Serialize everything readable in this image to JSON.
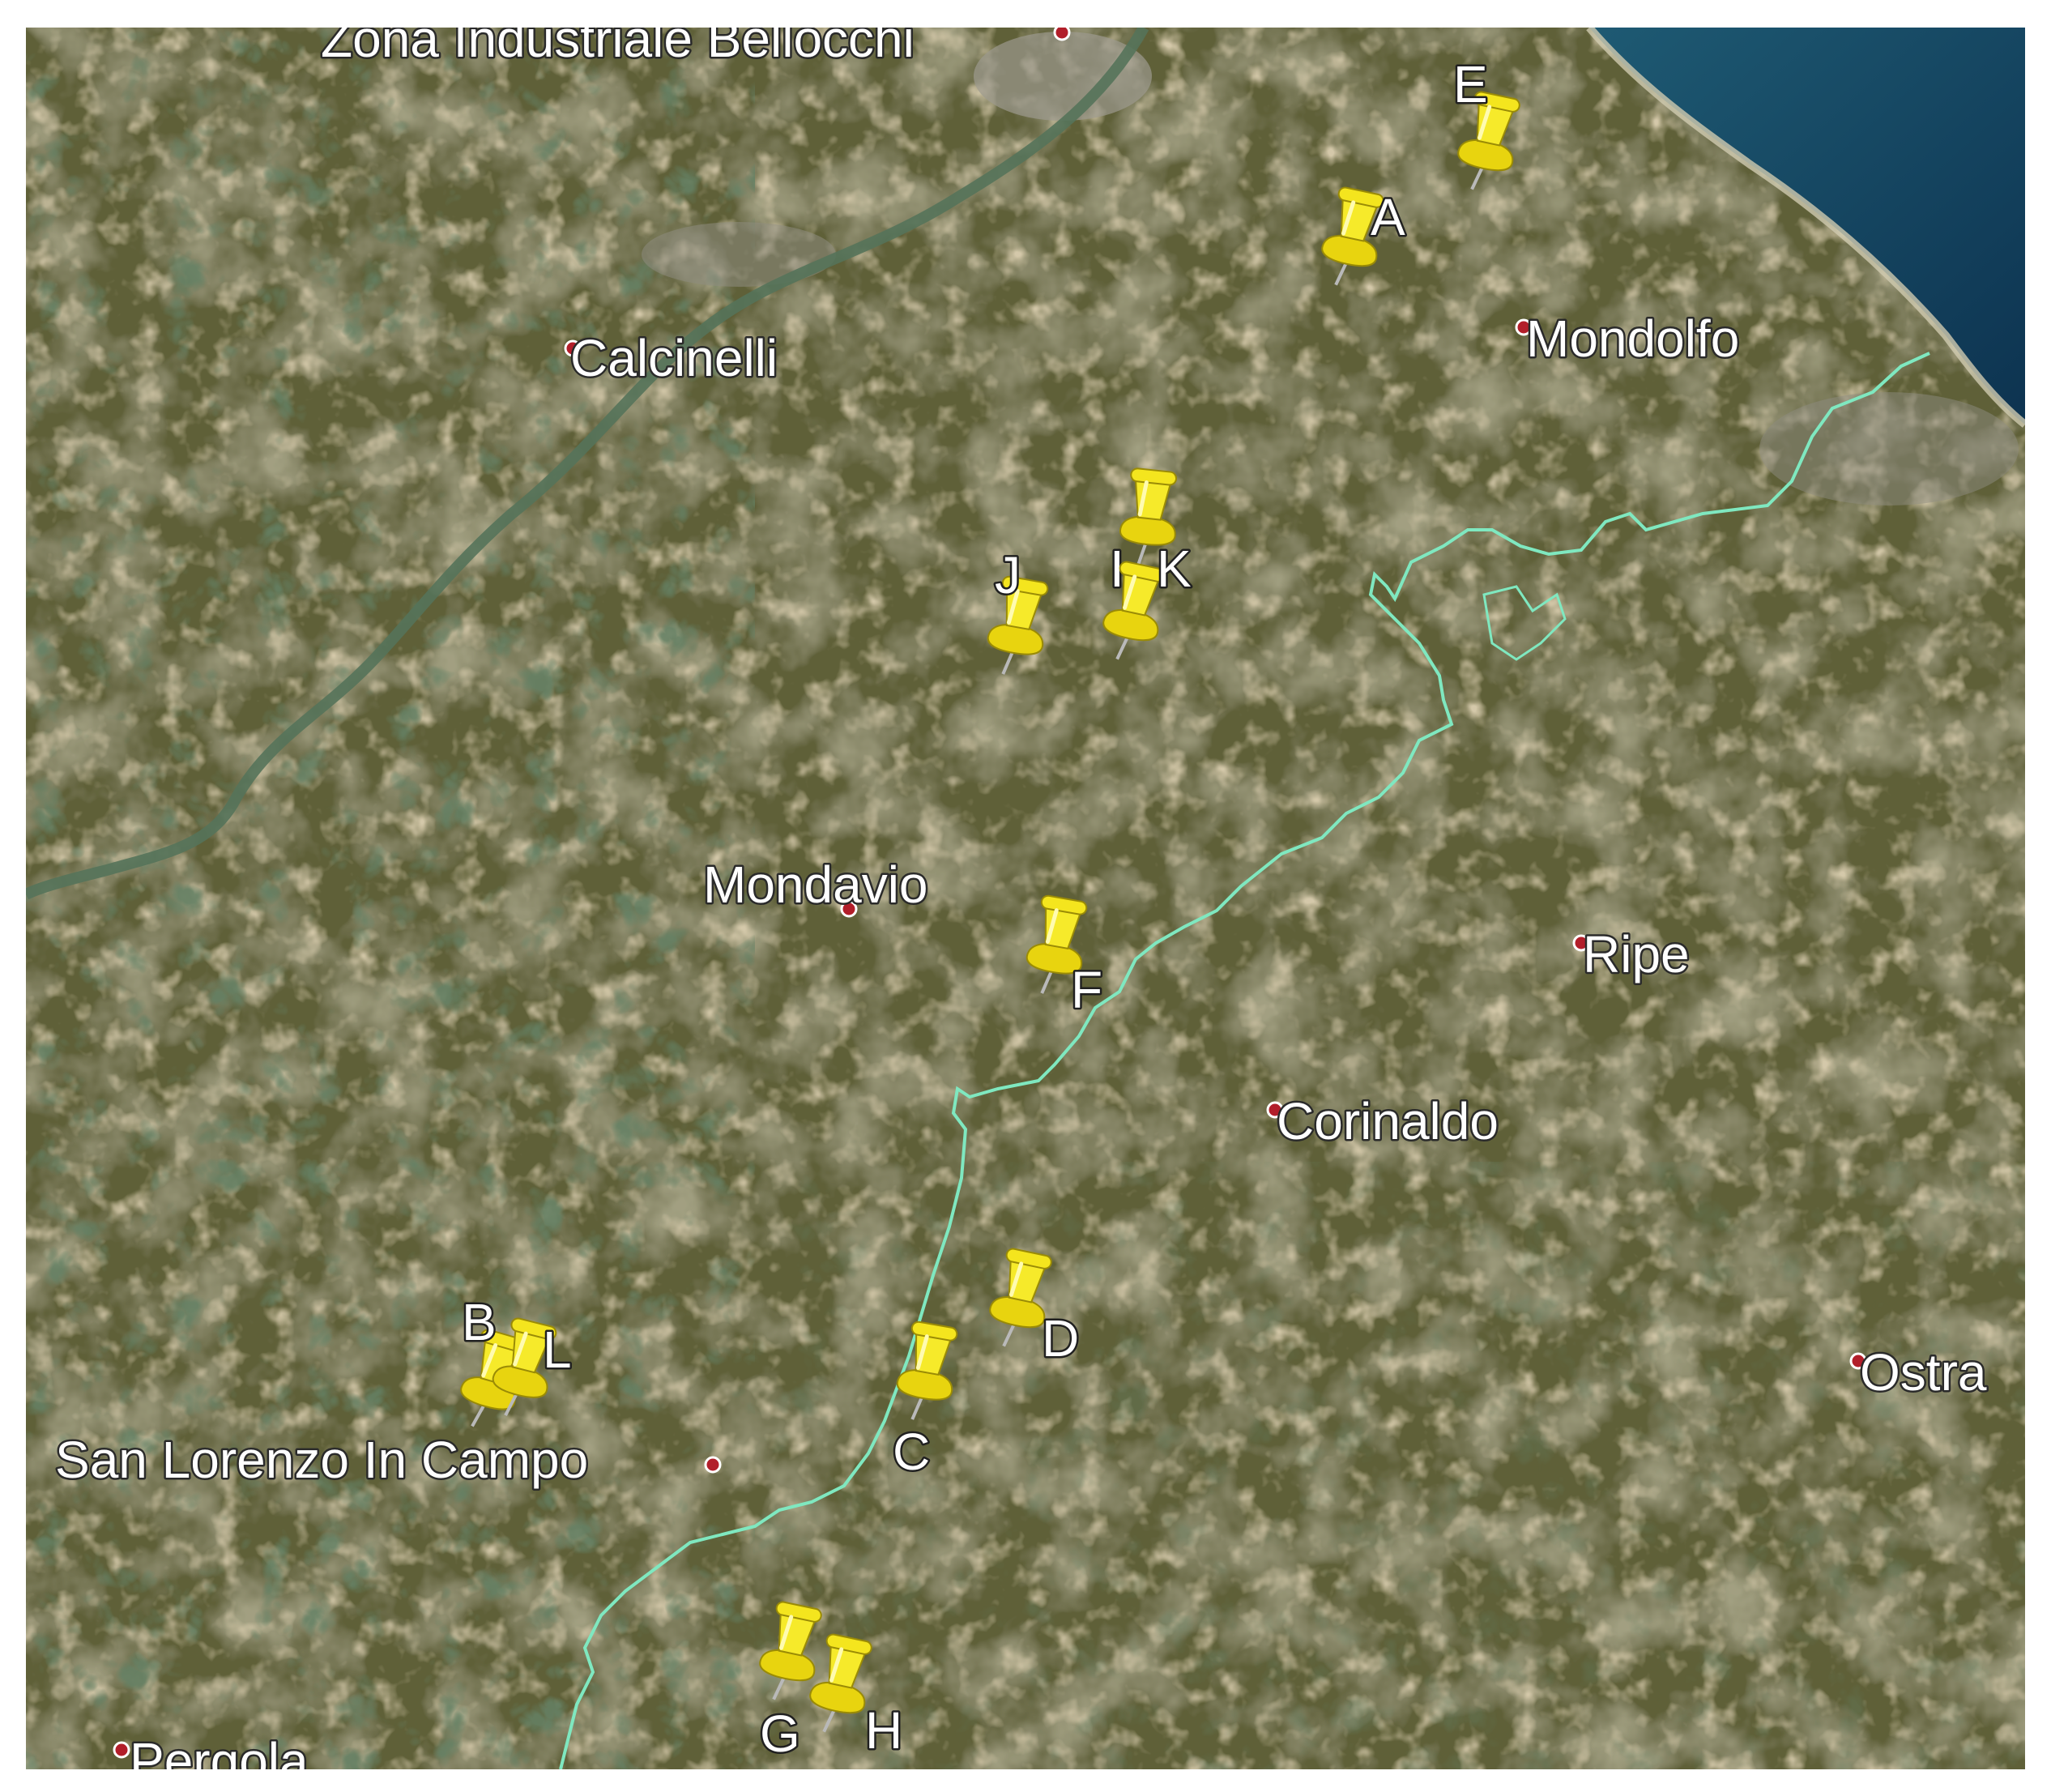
{
  "map": {
    "colors": {
      "terrain_base": "#6b6a3f",
      "field_light": "#a08f62",
      "forest_dark": "#263b22",
      "sea": "#123f5a",
      "boundary": "#7fe8c0",
      "pin": "#f3e620",
      "place_dot": "#b21e2a",
      "label_text": "#ffffff"
    },
    "places": [
      {
        "id": "zona-industriale-bellocchi",
        "name": "Zona Industriale Bellocchi"
      },
      {
        "id": "calcinelli",
        "name": "Calcinelli"
      },
      {
        "id": "mondolfo",
        "name": "Mondolfo"
      },
      {
        "id": "mondavio",
        "name": "Mondavio"
      },
      {
        "id": "ripe",
        "name": "Ripe"
      },
      {
        "id": "corinaldo",
        "name": "Corinaldo"
      },
      {
        "id": "ostra",
        "name": "Ostra"
      },
      {
        "id": "san-lorenzo-in-campo",
        "name": "San Lorenzo In Campo"
      },
      {
        "id": "pergola",
        "name": "Pergola"
      }
    ],
    "pins": [
      {
        "id": "A",
        "label": "A",
        "icon": "pushpin-icon"
      },
      {
        "id": "B",
        "label": "B",
        "icon": "pushpin-icon"
      },
      {
        "id": "C",
        "label": "C",
        "icon": "pushpin-icon"
      },
      {
        "id": "D",
        "label": "D",
        "icon": "pushpin-icon"
      },
      {
        "id": "E",
        "label": "E",
        "icon": "pushpin-icon"
      },
      {
        "id": "F",
        "label": "F",
        "icon": "pushpin-icon"
      },
      {
        "id": "G",
        "label": "G",
        "icon": "pushpin-icon"
      },
      {
        "id": "H",
        "label": "H",
        "icon": "pushpin-icon"
      },
      {
        "id": "I",
        "label": "I",
        "icon": "pushpin-icon"
      },
      {
        "id": "J",
        "label": "J",
        "icon": "pushpin-icon"
      },
      {
        "id": "K",
        "label": "K",
        "icon": "pushpin-icon"
      },
      {
        "id": "L",
        "label": "L",
        "icon": "pushpin-icon"
      }
    ]
  }
}
